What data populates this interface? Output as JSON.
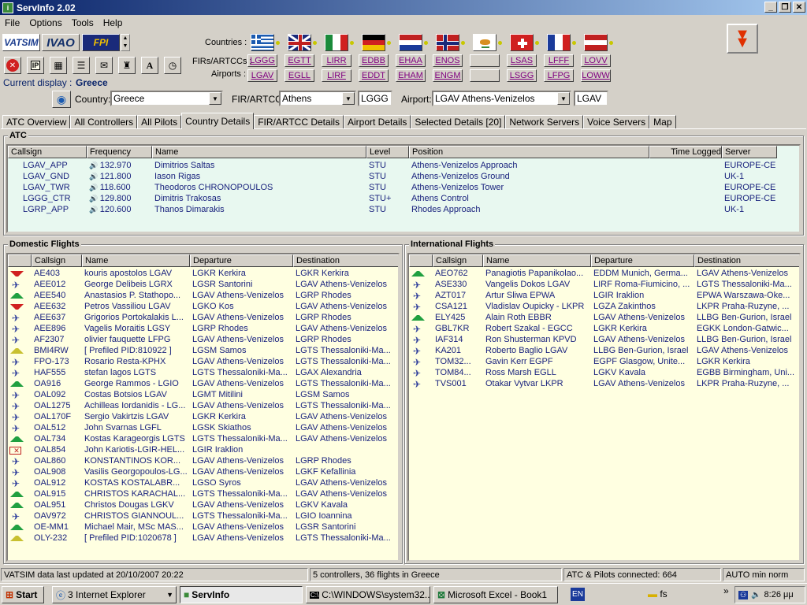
{
  "window": {
    "title": "ServInfo 2.02"
  },
  "menu": [
    "File",
    "Options",
    "Tools",
    "Help"
  ],
  "networks": {
    "vatsim": "VATSIM",
    "ivao": "IVAO",
    "fpi": "FPI"
  },
  "countries_label": "Countries :",
  "firs_label": "FIRs/ARTCCs :",
  "airports_label": "Airports :",
  "firs": [
    "LGGG",
    "EGTT",
    "LIRR",
    "EDBB",
    "EHAA",
    "ENOS",
    "",
    "LSAS",
    "LFFF",
    "LOVV"
  ],
  "airports": [
    "LGAV",
    "EGLL",
    "LIRF",
    "EDDT",
    "EHAM",
    "ENGM",
    "",
    "LSGG",
    "LFPG",
    "LOWW"
  ],
  "current_display": {
    "label": "Current display :",
    "value": "Greece"
  },
  "filters": {
    "country_label": "Country:",
    "country_value": "Greece",
    "fir_label": "FIR/ARTCC:",
    "fir_value": "Athens",
    "fir_code": "LGGG",
    "airport_label": "Airport:",
    "airport_value": "LGAV Athens-Venizelos",
    "airport_code": "LGAV"
  },
  "tabs": [
    "ATC Overview",
    "All Controllers",
    "All Pilots",
    "Country Details",
    "FIR/ARTCC Details",
    "Airport Details",
    "Selected Details [20]",
    "Network Servers",
    "Voice Servers",
    "Map"
  ],
  "atc": {
    "title": "ATC",
    "columns": [
      "Callsign",
      "Frequency",
      "Name",
      "Level",
      "Position",
      "Time Logged",
      "Server"
    ],
    "rows": [
      [
        "LGAV_APP",
        "132.970",
        "Dimitrios Saltas",
        "STU",
        "Athens-Venizelos Approach",
        "",
        "EUROPE-CE"
      ],
      [
        "LGAV_GND",
        "121.800",
        "Iason Rigas",
        "STU",
        "Athens-Venizelos Ground",
        "",
        "UK-1"
      ],
      [
        "LGAV_TWR",
        "118.600",
        "Theodoros CHRONOPOULOS",
        "STU",
        "Athens-Venizelos Tower",
        "",
        "EUROPE-CE"
      ],
      [
        "LGGG_CTR",
        "129.800",
        "Dimitris Trakosas",
        "STU+",
        "Athens Control",
        "",
        "EUROPE-CE"
      ],
      [
        "LGRP_APP",
        "120.600",
        "Thanos Dimarakis",
        "STU",
        "Rhodes Approach",
        "",
        "UK-1"
      ]
    ]
  },
  "domestic": {
    "title": "Domestic Flights",
    "columns": [
      "",
      "Callsign",
      "Name",
      "Departure",
      "Destination"
    ],
    "rows": [
      [
        "down",
        "AE403",
        "kouris apostolos LGAV",
        "LGKR Kerkira",
        "LGKR Kerkira"
      ],
      [
        "plane",
        "AEE012",
        "George Delibeis LGRX",
        "LGSR Santorini",
        "LGAV Athens-Venizelos"
      ],
      [
        "up",
        "AEE540",
        "Anastasios P. Stathopo...",
        "LGAV Athens-Venizelos",
        "LGRP Rhodes"
      ],
      [
        "down",
        "AEE632",
        "Petros Vassiliou LGAV",
        "LGKO Kos",
        "LGAV Athens-Venizelos"
      ],
      [
        "plane",
        "AEE637",
        "Grigorios Portokalakis L...",
        "LGAV Athens-Venizelos",
        "LGRP Rhodes"
      ],
      [
        "plane",
        "AEE896",
        "Vagelis Moraitis LGSY",
        "LGRP Rhodes",
        "LGAV Athens-Venizelos"
      ],
      [
        "plane",
        "AF2307",
        "olivier fauquette LFPG",
        "LGAV Athens-Venizelos",
        "LGRP Rhodes"
      ],
      [
        "prefiled",
        "BMI4RW",
        "[ Prefiled PID:810922 ]",
        "LGSM Samos",
        "LGTS Thessaloniki-Ma..."
      ],
      [
        "plane",
        "FPO-173",
        "Rosario Resta-KPHX",
        "LGAV Athens-Venizelos",
        "LGTS Thessaloniki-Ma..."
      ],
      [
        "plane",
        "HAF555",
        "stefan lagos LGTS",
        "LGTS Thessaloniki-Ma...",
        "LGAX Alexandria"
      ],
      [
        "up",
        "OA916",
        "George Rammos - LGIO",
        "LGAV Athens-Venizelos",
        "LGTS Thessaloniki-Ma..."
      ],
      [
        "plane",
        "OAL092",
        "Costas Botsios LGAV",
        "LGMT Mitilini",
        "LGSM Samos"
      ],
      [
        "plane",
        "OAL1275",
        "Achilleas Iordanidis - LG...",
        "LGAV Athens-Venizelos",
        "LGTS Thessaloniki-Ma..."
      ],
      [
        "plane",
        "OAL170F",
        "Sergio Vakirtzis LGAV",
        "LGKR Kerkira",
        "LGAV Athens-Venizelos"
      ],
      [
        "plane",
        "OAL512",
        "John Svarnas LGFL",
        "LGSK Skiathos",
        "LGAV Athens-Venizelos"
      ],
      [
        "up",
        "OAL734",
        "Kostas Karageorgis LGTS",
        "LGTS Thessaloniki-Ma...",
        "LGAV Athens-Venizelos"
      ],
      [
        "crossed",
        "OAL854",
        "John Kariotis-LGIR-HEL...",
        "LGIR Iraklion",
        ""
      ],
      [
        "plane",
        "OAL860",
        "KONSTANTINOS KOR...",
        "LGAV Athens-Venizelos",
        "LGRP Rhodes"
      ],
      [
        "plane",
        "OAL908",
        "Vasilis Georgopoulos-LG...",
        "LGAV Athens-Venizelos",
        "LGKF Kefallinia"
      ],
      [
        "plane",
        "OAL912",
        "KOSTAS KOSTALABR...",
        "LGSO Syros",
        "LGAV Athens-Venizelos"
      ],
      [
        "up",
        "OAL915",
        "CHRISTOS KARACHAL...",
        "LGTS Thessaloniki-Ma...",
        "LGAV Athens-Venizelos"
      ],
      [
        "up",
        "OAL951",
        "Christos Dougas LGKV",
        "LGAV Athens-Venizelos",
        "LGKV Kavala"
      ],
      [
        "plane",
        "OAV972",
        "CHRISTOS GIANNOUL...",
        "LGTS Thessaloniki-Ma...",
        "LGIO Ioannina"
      ],
      [
        "up",
        "OE-MM1",
        "Michael Mair, MSc MAS...",
        "LGAV Athens-Venizelos",
        "LGSR Santorini"
      ],
      [
        "prefiled",
        "OLY-232",
        "[ Prefiled PID:1020678 ]",
        "LGAV Athens-Venizelos",
        "LGTS Thessaloniki-Ma..."
      ]
    ]
  },
  "international": {
    "title": "International Flights",
    "columns": [
      "",
      "Callsign",
      "Name",
      "Departure",
      "Destination"
    ],
    "rows": [
      [
        "up",
        "AEO762",
        "Panagiotis Papanikolao...",
        "EDDM Munich, Germa...",
        "LGAV Athens-Venizelos"
      ],
      [
        "plane",
        "ASE330",
        "Vangelis Dokos LGAV",
        "LIRF Roma-Fiumicino, ...",
        "LGTS Thessaloniki-Ma..."
      ],
      [
        "plane",
        "AZT017",
        "Artur Sliwa EPWA",
        "LGIR Iraklion",
        "EPWA Warszawa-Oke..."
      ],
      [
        "plane",
        "CSA121",
        "Vladislav Oupicky - LKPR",
        "LGZA Zakinthos",
        "LKPR Praha-Ruzyne, ..."
      ],
      [
        "up",
        "ELY425",
        "Alain Roth EBBR",
        "LGAV Athens-Venizelos",
        "LLBG Ben-Gurion, Israel"
      ],
      [
        "plane",
        "GBL7KR",
        "Robert Szakal - EGCC",
        "LGKR Kerkira",
        "EGKK London-Gatwic..."
      ],
      [
        "plane",
        "IAF314",
        "Ron Shusterman KPVD",
        "LGAV Athens-Venizelos",
        "LLBG Ben-Gurion, Israel"
      ],
      [
        "plane",
        "KA201",
        "Roberto Baglio LGAV",
        "LLBG Ben-Gurion, Israel",
        "LGAV Athens-Venizelos"
      ],
      [
        "plane",
        "TOM32...",
        "Gavin Kerr EGPF",
        "EGPF Glasgow, Unite...",
        "LGKR Kerkira"
      ],
      [
        "plane",
        "TOM84...",
        "Ross Marsh EGLL",
        "LGKV Kavala",
        "EGBB Birmingham, Uni..."
      ],
      [
        "plane",
        "TVS001",
        "Otakar Vytvar LKPR",
        "LGAV Athens-Venizelos",
        "LKPR Praha-Ruzyne, ..."
      ]
    ]
  },
  "status": {
    "updated": "VATSIM data last updated at 20/10/2007 20:22",
    "summary": "5 controllers, 36 flights in Greece",
    "connected": "ATC & Pilots connected: 664",
    "mode": "AUTO min norm"
  },
  "taskbar": {
    "start": "Start",
    "items": [
      "3 Internet Explorer",
      "ServInfo",
      "C:\\WINDOWS\\system32...",
      "Microsoft Excel - Book1"
    ],
    "lang": "EN",
    "folder": "fs",
    "clock": "8:26 μμ"
  },
  "colors": {
    "list_bg": "#ffffe1",
    "atc_bg": "#e8f8f0",
    "row_text": "#1a237e",
    "link": "#800080"
  }
}
